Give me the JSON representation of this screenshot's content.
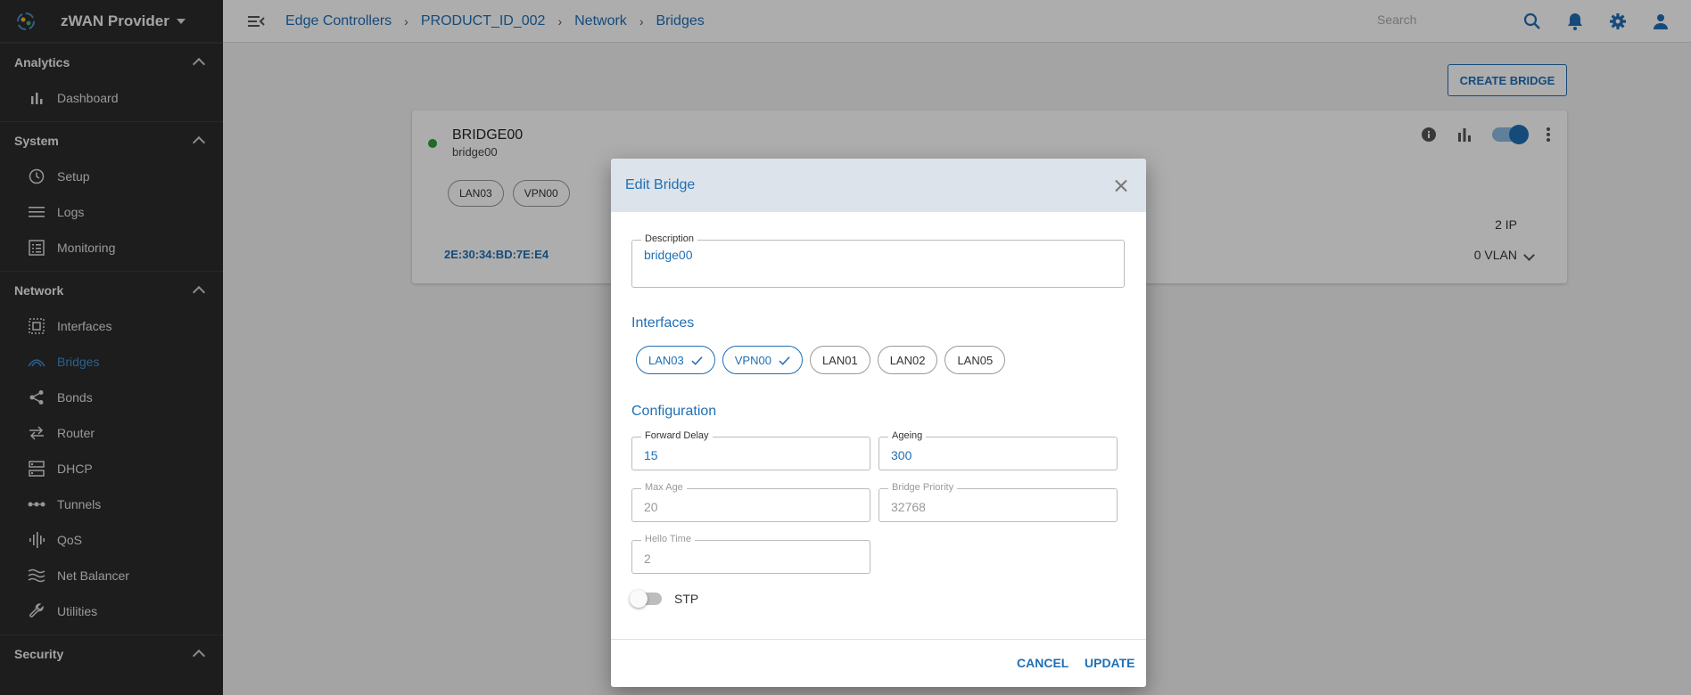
{
  "brand": {
    "name": "zWAN Provider"
  },
  "sidebar": {
    "sections": [
      {
        "title": "Analytics",
        "items": [
          {
            "label": "Dashboard",
            "icon": "bar-chart-icon"
          }
        ]
      },
      {
        "title": "System",
        "items": [
          {
            "label": "Setup",
            "icon": "clock-icon"
          },
          {
            "label": "Logs",
            "icon": "list-icon"
          },
          {
            "label": "Monitoring",
            "icon": "monitoring-icon"
          }
        ]
      },
      {
        "title": "Network",
        "items": [
          {
            "label": "Interfaces",
            "icon": "interfaces-icon"
          },
          {
            "label": "Bridges",
            "icon": "bridge-icon",
            "active": true
          },
          {
            "label": "Bonds",
            "icon": "share-icon"
          },
          {
            "label": "Router",
            "icon": "swap-arrows-icon"
          },
          {
            "label": "DHCP",
            "icon": "server-icon"
          },
          {
            "label": "Tunnels",
            "icon": "tunnel-icon"
          },
          {
            "label": "QoS",
            "icon": "equalizer-icon"
          },
          {
            "label": "Net Balancer",
            "icon": "waves-icon"
          },
          {
            "label": "Utilities",
            "icon": "wrench-icon"
          }
        ]
      },
      {
        "title": "Security",
        "items": []
      }
    ]
  },
  "header": {
    "breadcrumb": [
      "Edge Controllers",
      "PRODUCT_ID_002",
      "Network",
      "Bridges"
    ],
    "search_placeholder": "Search"
  },
  "page": {
    "create_label": "CREATE BRIDGE",
    "bridge": {
      "name": "BRIDGE00",
      "description": "bridge00",
      "interfaces": [
        "LAN03",
        "VPN00"
      ],
      "mac": "2E:30:34:BD:7E:E4",
      "ip_count": "2 IP",
      "vlan_count": "0 VLAN",
      "status_color": "#2e9b3e"
    }
  },
  "dialog": {
    "title": "Edit Bridge",
    "description_label": "Description",
    "description_value": "bridge00",
    "interfaces_title": "Interfaces",
    "interfaces": [
      {
        "label": "LAN03",
        "selected": true
      },
      {
        "label": "VPN00",
        "selected": true
      },
      {
        "label": "LAN01",
        "selected": false
      },
      {
        "label": "LAN02",
        "selected": false
      },
      {
        "label": "LAN05",
        "selected": false
      }
    ],
    "configuration_title": "Configuration",
    "forward_delay": {
      "label": "Forward Delay",
      "value": "15"
    },
    "ageing": {
      "label": "Ageing",
      "value": "300"
    },
    "max_age": {
      "label": "Max Age",
      "value": "20"
    },
    "bridge_priority": {
      "label": "Bridge Priority",
      "value": "32768"
    },
    "hello_time": {
      "label": "Hello Time",
      "value": "2"
    },
    "stp_label": "STP",
    "stp_enabled": false,
    "cancel_label": "CANCEL",
    "update_label": "UPDATE"
  },
  "colors": {
    "accent": "#1f6fb5",
    "sidebar": "#2b2b2b"
  }
}
